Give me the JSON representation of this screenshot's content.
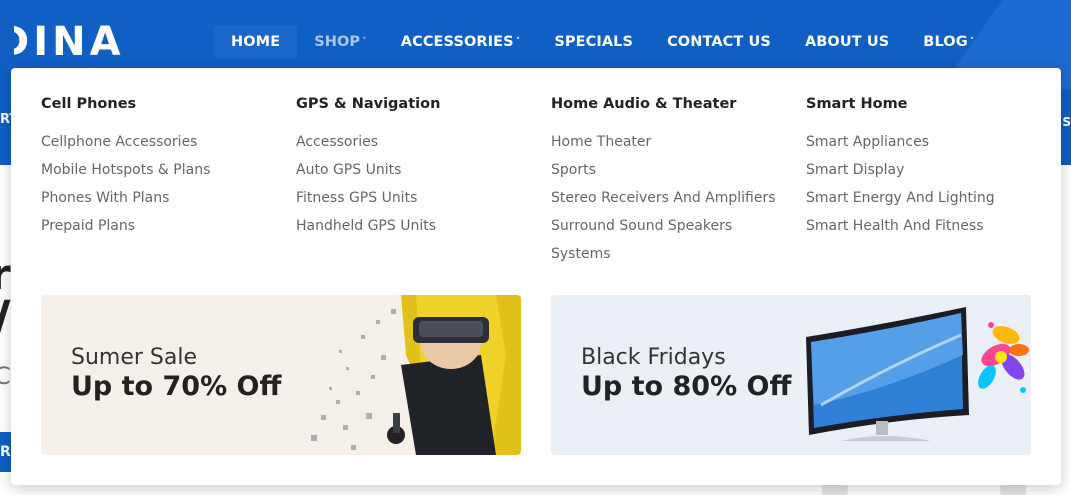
{
  "logo": {
    "text": "DINA"
  },
  "nav": {
    "items": [
      {
        "label": "HOME",
        "caret": ""
      },
      {
        "label": "SHOP",
        "caret": "˅"
      },
      {
        "label": "ACCESSORIES",
        "caret": "˅"
      },
      {
        "label": "SPECIALS",
        "caret": ""
      },
      {
        "label": "CONTACT US",
        "caret": ""
      },
      {
        "label": "ABOUT US",
        "caret": ""
      },
      {
        "label": "BLOG",
        "caret": "˅"
      }
    ]
  },
  "side": {
    "left": "RT",
    "right": "e S"
  },
  "background": {
    "glyph1": "r",
    "glyph2": "/",
    "glyph3": "C",
    "button": "RE"
  },
  "mega_menu": {
    "columns": [
      {
        "title": "Cell Phones",
        "links": [
          "Cellphone Accessories",
          "Mobile Hotspots & Plans",
          "Phones With Plans",
          "Prepaid Plans"
        ]
      },
      {
        "title": "GPS & Navigation",
        "links": [
          "Accessories",
          "Auto GPS Units",
          "Fitness GPS Units",
          "Handheld GPS Units"
        ]
      },
      {
        "title": "Home Audio & Theater",
        "links": [
          "Home Theater",
          "Sports",
          "Stereo Receivers And Amplifiers",
          "Surround Sound Speakers",
          "Systems"
        ]
      },
      {
        "title": "Smart Home",
        "links": [
          "Smart Appliances",
          "Smart Display",
          "Smart Energy And Lighting",
          "Smart Health And Fitness"
        ]
      }
    ],
    "banners": [
      {
        "subtitle": "Sumer Sale",
        "title": "Up to 70% Off"
      },
      {
        "subtitle": "Black Fridays",
        "title": "Up to 80% Off"
      }
    ]
  },
  "colors": {
    "brand_blue": "#0f5fc5",
    "menu_text": "#666666",
    "heading_text": "#222222"
  }
}
